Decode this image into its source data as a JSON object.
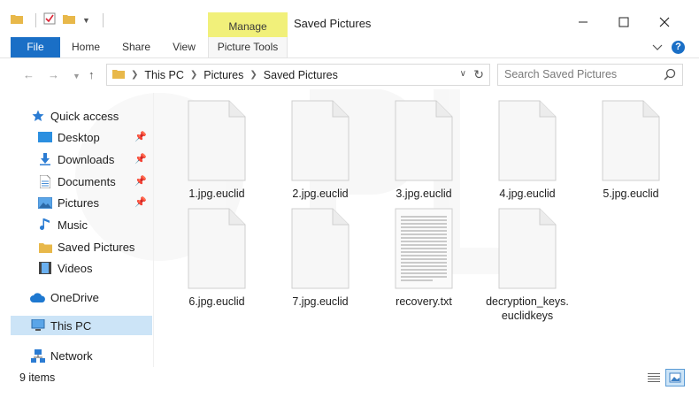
{
  "window": {
    "title": "Saved Pictures",
    "context_tab": "Manage"
  },
  "ribbon": {
    "tabs": [
      "File",
      "Home",
      "Share",
      "View",
      "Picture Tools"
    ]
  },
  "address": {
    "breadcrumb": [
      "This PC",
      "Pictures",
      "Saved Pictures"
    ]
  },
  "search": {
    "placeholder": "Search Saved Pictures"
  },
  "sidebar": {
    "items": [
      {
        "label": "Quick access",
        "icon": "star-icon"
      },
      {
        "label": "Desktop",
        "icon": "desktop-icon",
        "pinned": true
      },
      {
        "label": "Downloads",
        "icon": "download-icon",
        "pinned": true
      },
      {
        "label": "Documents",
        "icon": "documents-icon",
        "pinned": true
      },
      {
        "label": "Pictures",
        "icon": "pictures-icon",
        "pinned": true
      },
      {
        "label": "Music",
        "icon": "music-icon"
      },
      {
        "label": "Saved Pictures",
        "icon": "folder-icon"
      },
      {
        "label": "Videos",
        "icon": "videos-icon"
      },
      {
        "label": "OneDrive",
        "icon": "cloud-icon"
      },
      {
        "label": "This PC",
        "icon": "computer-icon",
        "selected": true
      },
      {
        "label": "Network",
        "icon": "network-icon"
      }
    ]
  },
  "files": [
    {
      "name": "1.jpg.euclid",
      "type": "blank"
    },
    {
      "name": "2.jpg.euclid",
      "type": "blank"
    },
    {
      "name": "3.jpg.euclid",
      "type": "blank"
    },
    {
      "name": "4.jpg.euclid",
      "type": "blank"
    },
    {
      "name": "5.jpg.euclid",
      "type": "blank"
    },
    {
      "name": "6.jpg.euclid",
      "type": "blank"
    },
    {
      "name": "7.jpg.euclid",
      "type": "blank"
    },
    {
      "name": "recovery.txt",
      "type": "text"
    },
    {
      "name_line1": "decryption_keys.",
      "name_line2": "euclidkeys",
      "type": "blank"
    }
  ],
  "status": {
    "item_count": "9 items"
  },
  "colors": {
    "accent": "#1a6fc6",
    "manage_highlight": "#f1f07a",
    "selection": "#cce4f7"
  }
}
